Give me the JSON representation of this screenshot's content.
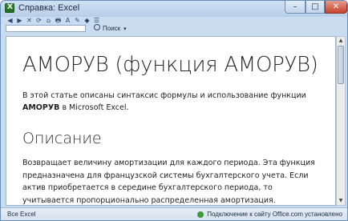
{
  "window": {
    "title": "Справка: Excel",
    "minimize": "–",
    "maximize": "□",
    "close": "✕"
  },
  "toolbar": {
    "buttons": [
      "◀",
      "▶",
      "✕",
      "⟳",
      "⌂",
      "🖶",
      "A",
      "✎",
      "◆",
      "☰"
    ]
  },
  "search": {
    "label": "Поиск",
    "caret": "▾"
  },
  "article": {
    "title": "АМОРУВ (функция АМОРУВ)",
    "intro_prefix": "В этой статье описаны синтаксис формулы и использование функции ",
    "intro_bold": "АМОРУВ",
    "intro_suffix": " в Microsoft Excel.",
    "section_heading": "Описание",
    "description": "Возвращает величину амортизации для каждого периода. Эта функция предназначена для французской системы бухгалтерского учета. Если актив приобретается в середине бухгалтерского периода, то учитывается пропорционально распределенная амортизация."
  },
  "scrollbar": {
    "up": "▲",
    "down": "▼"
  },
  "status": {
    "left": "Все Excel",
    "right": "Подключение к сайту Office.com установлено"
  }
}
